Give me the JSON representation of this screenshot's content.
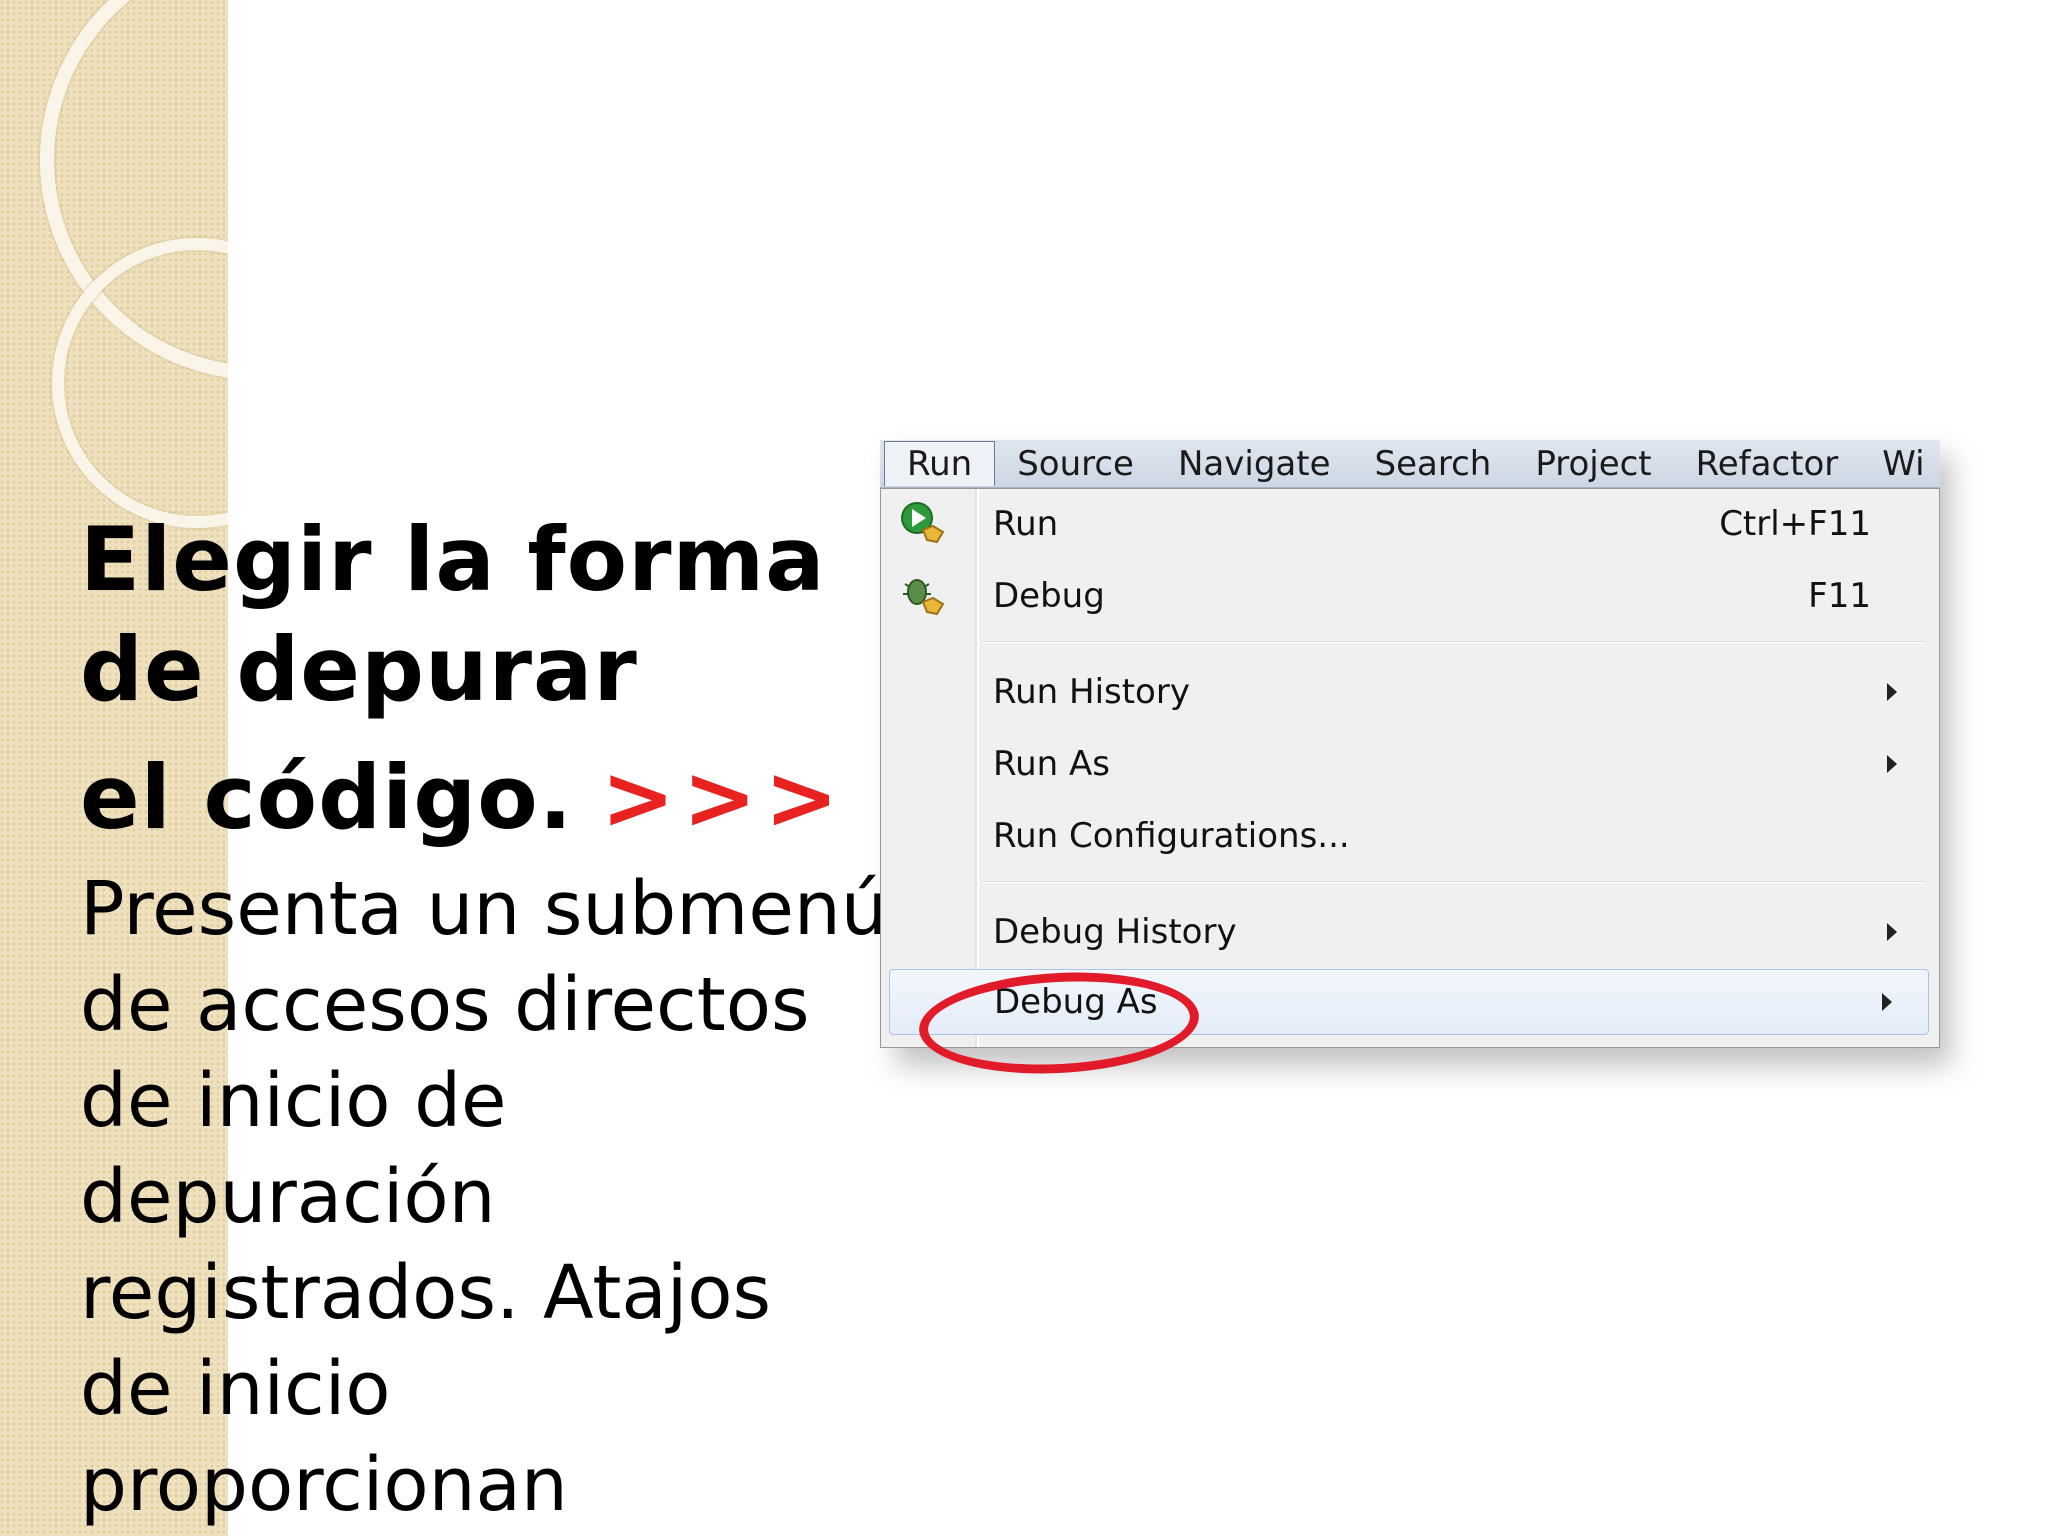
{
  "slide": {
    "heading_lines": [
      "Elegir la forma",
      "de depurar",
      "el código."
    ],
    "heading_arrows": ">>>",
    "body_lines": [
      "Presenta un submenú",
      "de accesos directos",
      "de inicio de",
      "depuración",
      "registrados. Atajos",
      "de inicio",
      "proporcionan"
    ],
    "arrow_color": "#e8231f"
  },
  "menubar": {
    "items": [
      "Run",
      "Source",
      "Navigate",
      "Search",
      "Project",
      "Refactor",
      "Wi"
    ],
    "active": "Run"
  },
  "run_menu": {
    "items": [
      {
        "label": "Run",
        "shortcut": "Ctrl+F11",
        "icon": "run-launch-icon"
      },
      {
        "label": "Debug",
        "shortcut": "F11",
        "icon": "debug-bug-icon"
      },
      {
        "label": "Run History",
        "submenu": true
      },
      {
        "label": "Run As",
        "submenu": true
      },
      {
        "label": "Run Configurations...",
        "submenu": false
      },
      {
        "label": "Debug History",
        "submenu": true
      },
      {
        "label": "Debug As",
        "submenu": true,
        "highlighted": true,
        "circled": true
      }
    ],
    "highlight_color": "#e21b2b"
  }
}
